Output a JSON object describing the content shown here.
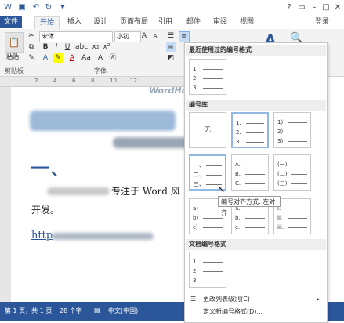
{
  "titlebar": {
    "quick_access_icons": [
      "word-icon",
      "save-icon",
      "undo-icon",
      "redo-icon"
    ],
    "window_icons": [
      "help-icon",
      "restore-icon",
      "minimize-icon",
      "maximize-icon",
      "close-icon"
    ]
  },
  "tabs": [
    "文件",
    "开始",
    "插入",
    "设计",
    "页面布局",
    "引用",
    "邮件",
    "审阅",
    "视图"
  ],
  "login_label": "登录",
  "ribbon": {
    "paste_label": "粘贴",
    "font_name": "宋体",
    "font_size": "小初",
    "clipboard_group": "剪贴板",
    "font_group": "字体",
    "bold": "B",
    "italic": "I",
    "underline": "U",
    "font_color": "A",
    "shrink_font": "A"
  },
  "ruler": {
    "marks": [
      "2",
      "4",
      "6",
      "8",
      "10",
      "12"
    ]
  },
  "document": {
    "heading_glyph": "一、",
    "para_text": "专注于 Word 风",
    "para_text2": "开发。",
    "link_text": "http",
    "bg_word": "WordHo"
  },
  "status": {
    "page": "第 1 页，共 1 页",
    "words": "28 个字",
    "lang": "中文(中国)"
  },
  "menu": {
    "recent_header": "最近使用过的编号格式",
    "library_header": "编号库",
    "doc_header": "文档编号格式",
    "none_label": "无",
    "tooltip": "编号对齐方式: 左对齐",
    "change_level": "更改列表级别(C)",
    "define_new": "定义新编号格式(D)..."
  },
  "tiles": {
    "recent": [
      "1.",
      "2.",
      "3."
    ],
    "lib_row1_b": [
      "1.",
      "2.",
      "3."
    ],
    "lib_row1_c": [
      "1)",
      "2)",
      "3)"
    ],
    "lib_row2_a": [
      "一、",
      "二、",
      "三、"
    ],
    "lib_row2_b": [
      "A.",
      "B.",
      "C."
    ],
    "lib_row2_c": [
      "(一)",
      "(二)",
      "(三)"
    ],
    "lib_row3_a": [
      "a)",
      "b)",
      "c)"
    ],
    "lib_row3_b": [
      "a.",
      "b.",
      "c."
    ],
    "lib_row3_c": [
      "i.",
      "ii.",
      "iii."
    ],
    "doc": [
      "1.",
      "2.",
      "3."
    ]
  }
}
